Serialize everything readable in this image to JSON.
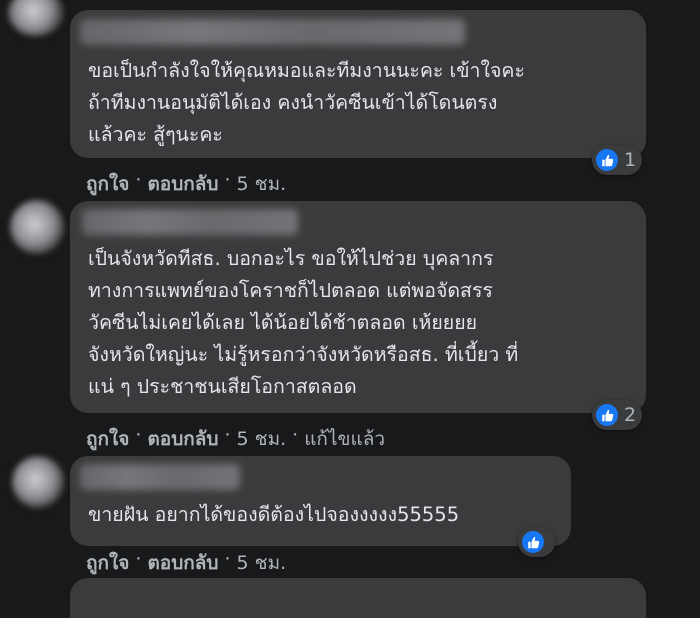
{
  "comments": [
    {
      "lines": [
        "ขอเป็นกำลังใจให้คุณหมอและทีมงานนะคะ เข้าใจคะ",
        "ถ้าทีมงานอนุมัติได้เอง คงนำวัคซีนเข้าได้โดนตรง",
        "แล้วคะ สู้ๆนะคะ"
      ],
      "reaction_count": "1",
      "like_label": "ถูกใจ",
      "reply_label": "ตอบกลับ",
      "time": "5 ชม.",
      "edited": ""
    },
    {
      "lines": [
        "เป็นจังหวัดทีสธ. บอกอะไร ขอให้ไปช่วย บุคลากร",
        "ทางการแพทย์ของโคราชก็ไปตลอด แต่พอจัดสรร",
        "วัคซีนไม่เคยได้เลย ได้น้อยได้ช้าตลอด เห้ยยยย",
        "จังหวัดใหญ่นะ ไม่รู้หรอกว่าจังหวัดหรือสธ. ที่เบี้ยว ที่",
        "แน่ ๆ ประชาชนเสียโอกาสตลอด"
      ],
      "reaction_count": "2",
      "like_label": "ถูกใจ",
      "reply_label": "ตอบกลับ",
      "time": "5 ชม.",
      "edited": "แก้ไขแล้ว"
    },
    {
      "lines": [
        "ขายฝัน อยากได้ของดีต้องไปจองงงงง55555"
      ],
      "reaction_count": "",
      "like_label": "ถูกใจ",
      "reply_label": "ตอบกลับ",
      "time": "5 ชม.",
      "edited": ""
    }
  ],
  "colors": {
    "background": "#18191a",
    "bubble": "#3a3b3c",
    "text": "#e4e6eb",
    "secondary_text": "#b0b3b8",
    "like_blue": "#1877f2"
  },
  "icons": {
    "reaction": "thumbs-up-icon"
  },
  "separator": "·"
}
